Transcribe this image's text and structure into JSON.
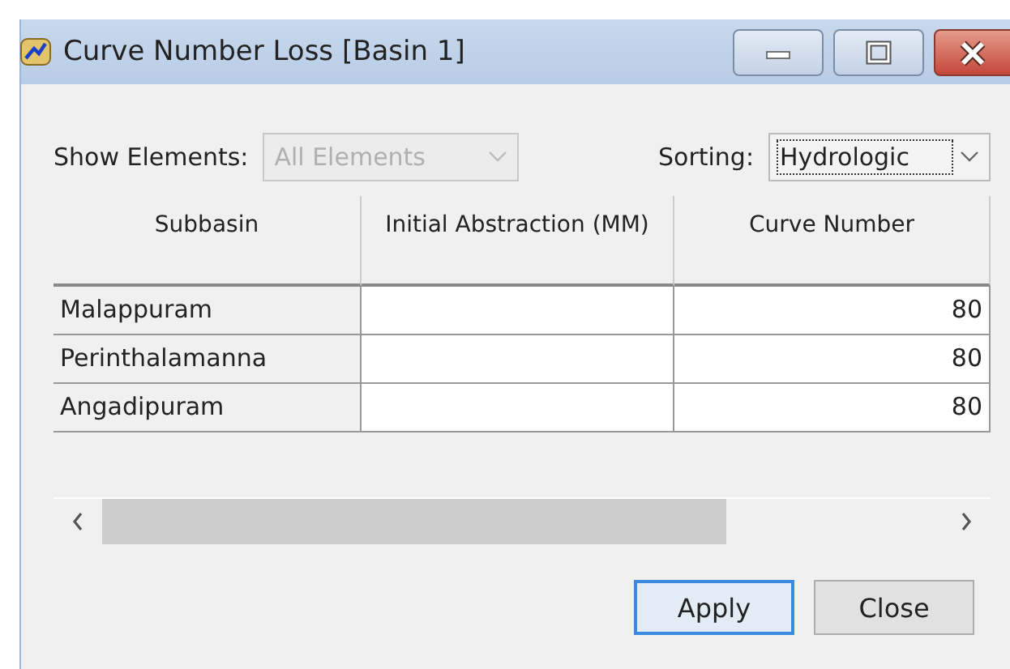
{
  "window": {
    "title": "Curve Number Loss [Basin 1]"
  },
  "filters": [
    {
      "label": "Show Elements:",
      "value": "All Elements",
      "disabled": true,
      "focused": false
    },
    {
      "label": "Sorting:",
      "value": "Hydrologic",
      "disabled": false,
      "focused": true
    }
  ],
  "table": {
    "columns": [
      {
        "label": "Subbasin",
        "kind": "name"
      },
      {
        "label": "Initial Abstraction (MM)",
        "kind": "number"
      },
      {
        "label": "Curve Number",
        "kind": "number"
      }
    ],
    "rows": [
      [
        "Malappuram",
        "",
        "80"
      ],
      [
        "Perinthalamanna",
        "",
        "80"
      ],
      [
        "Angadipuram",
        "",
        "80"
      ]
    ]
  },
  "buttons": [
    {
      "label": "Apply",
      "default": true
    },
    {
      "label": "Close",
      "default": false
    }
  ]
}
